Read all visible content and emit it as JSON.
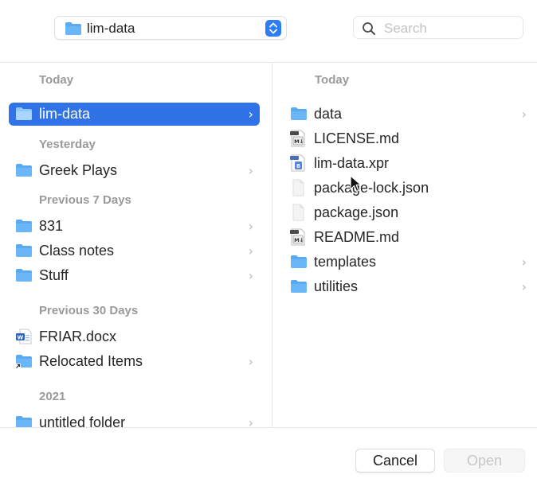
{
  "toolbar": {
    "location": "lim-data",
    "search_placeholder": "Search"
  },
  "left_column": {
    "today_label": "Today",
    "today_item": "lim-data",
    "yesterday_label": "Yesterday",
    "yesterday_item": "Greek Plays",
    "prev7_label": "Previous 7 Days",
    "prev7_items": [
      "831",
      "Class notes",
      "Stuff"
    ],
    "prev30_label": "Previous 30 Days",
    "prev30_items": [
      "FRIAR.docx",
      "Relocated Items"
    ],
    "year_label": "2021",
    "year_items": [
      "untitled folder"
    ]
  },
  "right_column": {
    "header": "Today",
    "items": [
      "data",
      "LICENSE.md",
      "lim-data.xpr",
      "package-lock.json",
      "package.json",
      "README.md",
      "templates",
      "utilities"
    ]
  },
  "buttons": {
    "cancel": "Cancel",
    "open": "Open"
  },
  "colors": {
    "selection": "#2f73e6",
    "folder": "#5aaaf2",
    "section_label": "#9a9a9a"
  },
  "icons": {
    "folder": "folder-icon",
    "markdown": "markdown-file-icon",
    "xpr": "xpr-file-icon",
    "json": "document-icon",
    "word": "word-document-icon",
    "alias": "alias-folder-icon",
    "search": "search-icon",
    "chevron": "chevron-right-icon"
  }
}
